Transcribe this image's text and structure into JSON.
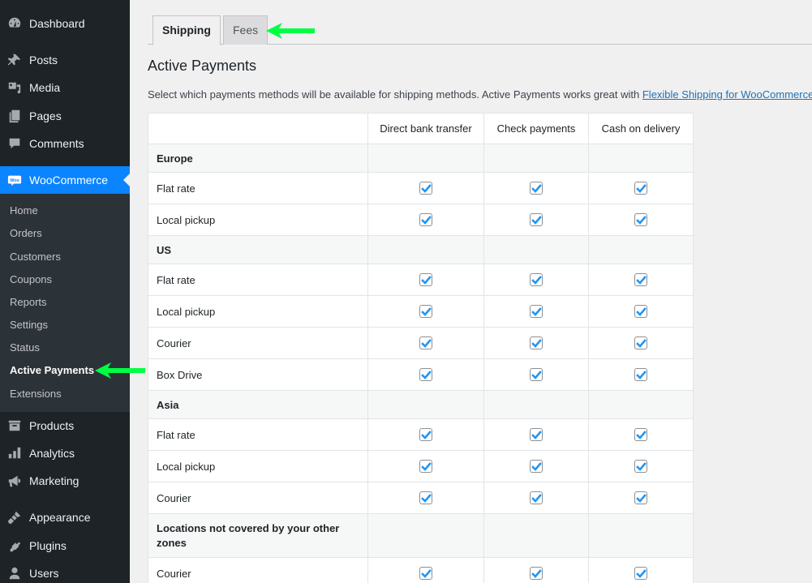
{
  "sidebar": {
    "menu": [
      {
        "label": "Dashboard",
        "icon": "dashboard-icon"
      },
      {
        "label": "Posts",
        "icon": "pin-icon"
      },
      {
        "label": "Media",
        "icon": "media-icon"
      },
      {
        "label": "Pages",
        "icon": "pages-icon"
      },
      {
        "label": "Comments",
        "icon": "comment-icon"
      },
      {
        "label": "WooCommerce",
        "icon": "woo-icon"
      },
      {
        "label": "Products",
        "icon": "archive-icon"
      },
      {
        "label": "Analytics",
        "icon": "bar-chart-icon"
      },
      {
        "label": "Marketing",
        "icon": "megaphone-icon"
      },
      {
        "label": "Appearance",
        "icon": "paintbrush-icon"
      },
      {
        "label": "Plugins",
        "icon": "plug-icon"
      },
      {
        "label": "Users",
        "icon": "user-icon"
      }
    ],
    "woo_submenu": [
      "Home",
      "Orders",
      "Customers",
      "Coupons",
      "Reports",
      "Settings",
      "Status",
      "Active Payments",
      "Extensions"
    ],
    "current_menu": "WooCommerce",
    "current_submenu": "Active Payments"
  },
  "tabs": [
    {
      "label": "Shipping",
      "active": true
    },
    {
      "label": "Fees",
      "active": false
    }
  ],
  "page": {
    "title": "Active Payments",
    "intro_text": "Select which payments methods will be available for shipping methods. Active Payments works great with ",
    "intro_link": "Flexible Shipping for WooCommerce",
    "intro_end": "."
  },
  "table": {
    "columns": [
      "",
      "Direct bank transfer",
      "Check payments",
      "Cash on delivery"
    ],
    "rows": [
      {
        "type": "zone",
        "label": "Europe"
      },
      {
        "type": "method",
        "label": "Flat rate",
        "checked": [
          true,
          true,
          true
        ]
      },
      {
        "type": "method",
        "label": "Local pickup",
        "checked": [
          true,
          true,
          true
        ]
      },
      {
        "type": "zone",
        "label": "US"
      },
      {
        "type": "method",
        "label": "Flat rate",
        "checked": [
          true,
          true,
          true
        ]
      },
      {
        "type": "method",
        "label": "Local pickup",
        "checked": [
          true,
          true,
          true
        ]
      },
      {
        "type": "method",
        "label": "Courier",
        "checked": [
          true,
          true,
          true
        ]
      },
      {
        "type": "method",
        "label": "Box Drive",
        "checked": [
          true,
          true,
          true
        ]
      },
      {
        "type": "zone",
        "label": "Asia"
      },
      {
        "type": "method",
        "label": "Flat rate",
        "checked": [
          true,
          true,
          true
        ]
      },
      {
        "type": "method",
        "label": "Local pickup",
        "checked": [
          true,
          true,
          true
        ]
      },
      {
        "type": "method",
        "label": "Courier",
        "checked": [
          true,
          true,
          true
        ]
      },
      {
        "type": "zone",
        "label": "Locations not covered by your other zones"
      },
      {
        "type": "method",
        "label": "Courier",
        "checked": [
          true,
          true,
          true
        ]
      }
    ]
  },
  "colors": {
    "sidebar_bg": "#1d2327",
    "submenu_bg": "#2c3338",
    "current_menu_bg": "#0a84ff",
    "checkbox_check": "#2196f3",
    "annotation_arrow": "#00ff44",
    "link": "#2271b1"
  }
}
